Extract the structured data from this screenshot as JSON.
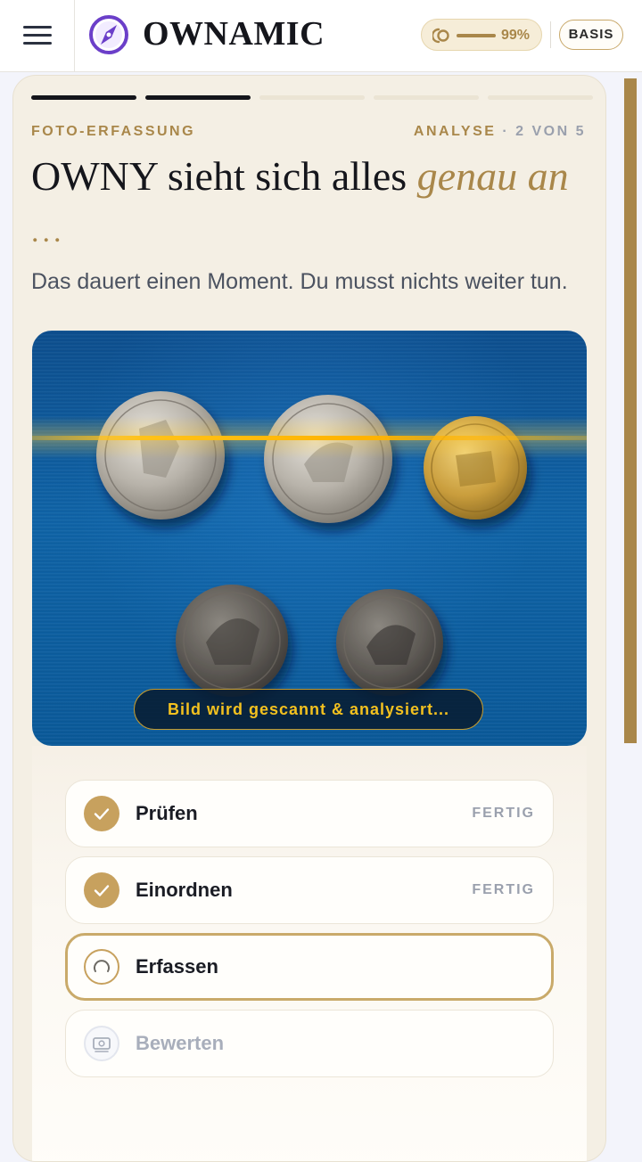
{
  "header": {
    "menu_icon": "hamburger-menu-icon",
    "logo_icon": "compass-logo-icon",
    "brand": "OWNAMIC",
    "progress_percent_text": "99%",
    "progress_value": 0.99,
    "plan_label": "BASIS"
  },
  "card": {
    "steps_total": 5,
    "steps_done": 2,
    "eyebrow": "FOTO-ERFASSUNG",
    "phase": "ANALYSE",
    "step_indicator": "· 2 VON 5",
    "headline_main": "OWNY sieht sich alles ",
    "headline_accent": "genau an",
    "headline_ellipsis": "...",
    "subtitle": "Das dauert einen Moment. Du musst nichts weiter tun.",
    "scan_status": "Bild wird gescannt & analysiert..."
  },
  "checklist": [
    {
      "label": "Prüfen",
      "status": "FERTIG",
      "state": "done",
      "icon": "check-icon"
    },
    {
      "label": "Einordnen",
      "status": "FERTIG",
      "state": "done",
      "icon": "check-icon"
    },
    {
      "label": "Erfassen",
      "status": "",
      "state": "active",
      "icon": "spinner-icon"
    },
    {
      "label": "Bewerten",
      "status": "",
      "state": "pending",
      "icon": "money-icon"
    }
  ],
  "colors": {
    "accent_gold": "#a9874a",
    "ink": "#15161c",
    "card_bg": "#f4efe4",
    "scan_yellow": "#f3c11f"
  }
}
